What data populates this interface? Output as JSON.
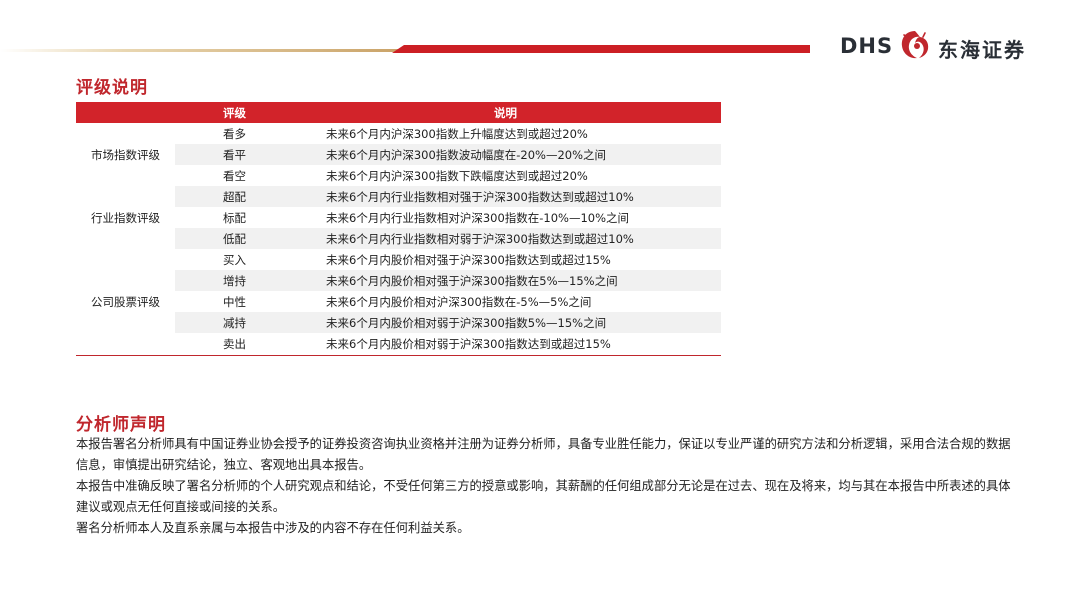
{
  "logo": {
    "latin": "DHS",
    "chinese": "东海证券"
  },
  "rating": {
    "title": "评级说明",
    "headers": {
      "level": "评级",
      "description": "说明"
    },
    "groups": [
      {
        "category": "市场指数评级",
        "rows": [
          {
            "level": "看多",
            "description": "未来6个月内沪深300指数上升幅度达到或超过20%"
          },
          {
            "level": "看平",
            "description": "未来6个月内沪深300指数波动幅度在-20%—20%之间"
          },
          {
            "level": "看空",
            "description": "未来6个月内沪深300指数下跌幅度达到或超过20%"
          }
        ]
      },
      {
        "category": "行业指数评级",
        "rows": [
          {
            "level": "超配",
            "description": "未来6个月内行业指数相对强于沪深300指数达到或超过10%"
          },
          {
            "level": "标配",
            "description": "未来6个月内行业指数相对沪深300指数在-10%—10%之间"
          },
          {
            "level": "低配",
            "description": "未来6个月内行业指数相对弱于沪深300指数达到或超过10%"
          }
        ]
      },
      {
        "category": "公司股票评级",
        "rows": [
          {
            "level": "买入",
            "description": "未来6个月内股价相对强于沪深300指数达到或超过15%"
          },
          {
            "level": "增持",
            "description": "未来6个月内股价相对强于沪深300指数在5%—15%之间"
          },
          {
            "level": "中性",
            "description": "未来6个月内股价相对沪深300指数在-5%—5%之间"
          },
          {
            "level": "减持",
            "description": "未来6个月内股价相对弱于沪深300指数5%—15%之间"
          },
          {
            "level": "卖出",
            "description": "未来6个月内股价相对弱于沪深300指数达到或超过15%"
          }
        ]
      }
    ]
  },
  "analyst": {
    "title": "分析师声明",
    "paragraphs": [
      "本报告署名分析师具有中国证券业协会授予的证券投资咨询执业资格并注册为证券分析师，具备专业胜任能力，保证以专业严谨的研究方法和分析逻辑，采用合法合规的数据信息，审慎提出研究结论，独立、客观地出具本报告。",
      "本报告中准确反映了署名分析师的个人研究观点和结论，不受任何第三方的授意或影响，其薪酬的任何组成部分无论是在过去、现在及将来，均与其在本报告中所表述的具体建议或观点无任何直接或间接的关系。",
      "署名分析师本人及直系亲属与本报告中涉及的内容不存在任何利益关系。"
    ]
  },
  "colors": {
    "accent": "#cc1f24",
    "title_red": "#c0272d",
    "row_shade": "#f1f1f1"
  }
}
